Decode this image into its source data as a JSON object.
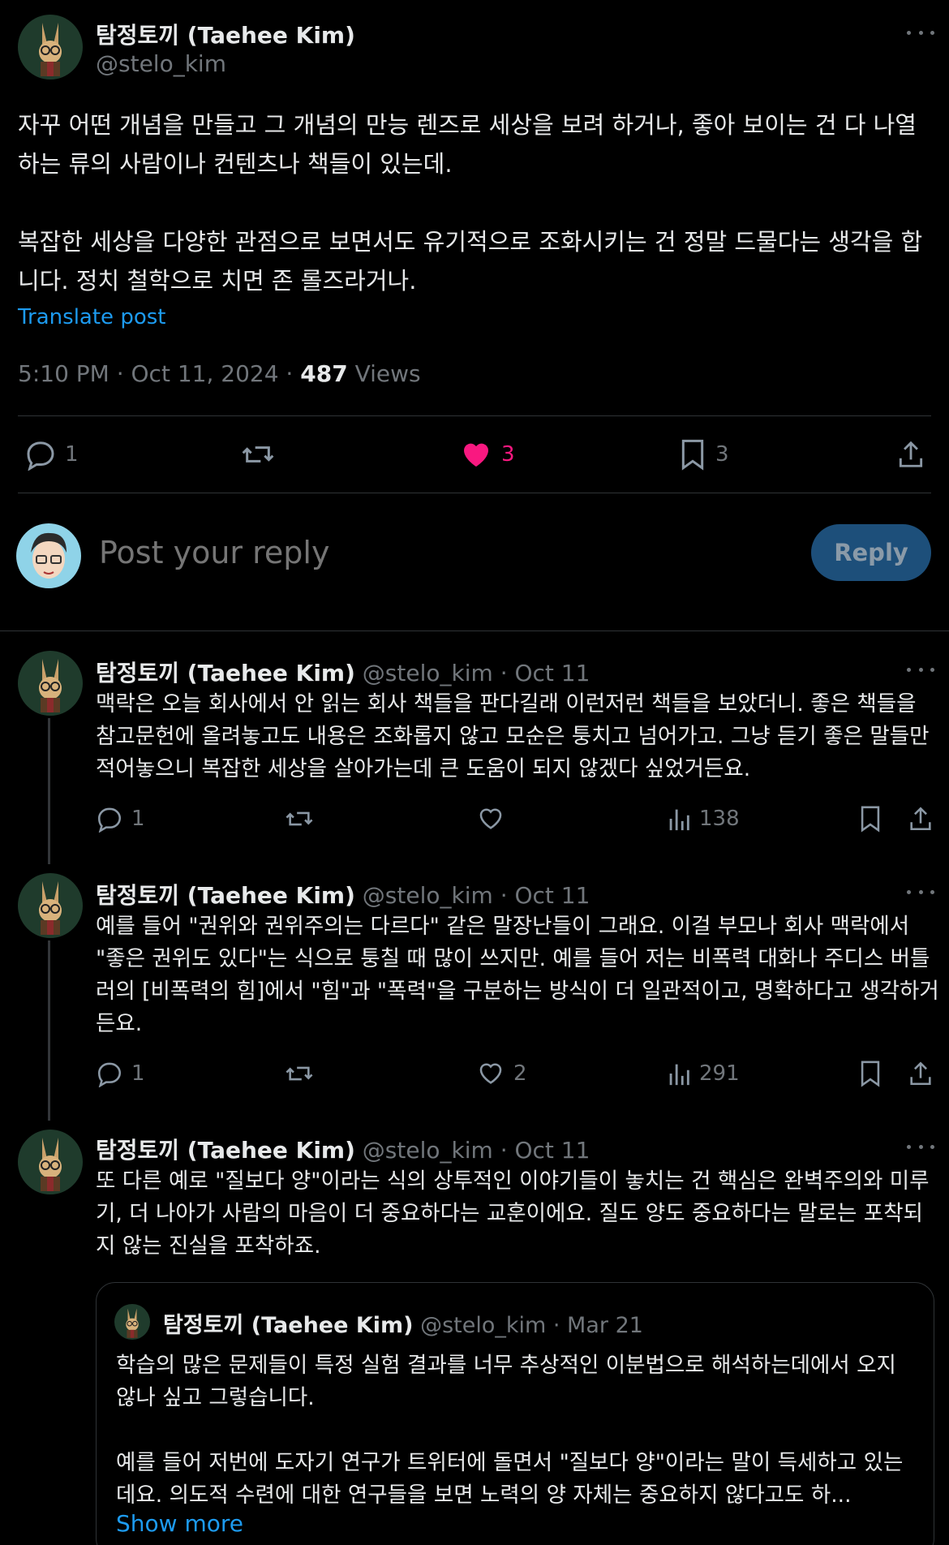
{
  "main_post": {
    "author_name": "탐정토끼 (Taehee Kim)",
    "handle": "@stelo_kim",
    "paragraphs": [
      "자꾸 어떤 개념을 만들고 그 개념의 만능 렌즈로 세상을 보려 하거나, 좋아 보이는 건 다 나열하는 류의 사람이나 컨텐츠나 책들이 있는데.",
      "복잡한 세상을 다양한 관점으로 보면서도 유기적으로 조화시키는 건 정말 드물다는 생각을 합니다. 정치 철학으로 치면 존 롤즈라거나."
    ],
    "translate_label": "Translate post",
    "timestamp": "5:10 PM · Oct 11, 2024 · ",
    "views_count": "487",
    "views_label": " Views",
    "actions": {
      "replies": "1",
      "likes": "3",
      "bookmarks": "3"
    },
    "like_color": "#f91880"
  },
  "composer": {
    "placeholder": "Post your reply",
    "reply_button": "Reply"
  },
  "replies": [
    {
      "author_name": "탐정토끼 (Taehee Kim)",
      "handle": "@stelo_kim",
      "date": "· Oct 11",
      "text": "맥락은 오늘 회사에서 안 읽는 회사 책들을 판다길래 이런저런 책들을 보았더니. 좋은 책들을 참고문헌에 올려놓고도 내용은 조화롭지 않고 모순은 퉁치고 넘어가고. 그냥 듣기 좋은 말들만 적어놓으니 복잡한 세상을 살아가는데 큰 도움이 되지 않겠다 싶었거든요.",
      "replies": "1",
      "likes": "",
      "views": "138"
    },
    {
      "author_name": "탐정토끼 (Taehee Kim)",
      "handle": "@stelo_kim",
      "date": "· Oct 11",
      "text": "예를 들어 \"권위와 권위주의는 다르다\" 같은 말장난들이 그래요. 이걸 부모나 회사 맥락에서 \"좋은 권위도 있다\"는 식으로 퉁칠 때 많이 쓰지만. 예를 들어 저는 비폭력 대화나 주디스 버틀러의 [비폭력의 힘]에서 \"힘\"과 \"폭력\"을 구분하는 방식이 더 일관적이고, 명확하다고 생각하거든요.",
      "replies": "1",
      "likes": "2",
      "views": "291"
    },
    {
      "author_name": "탐정토끼 (Taehee Kim)",
      "handle": "@stelo_kim",
      "date": "· Oct 11",
      "text": "또 다른 예로 \"질보다 양\"이라는 식의 상투적인 이야기들이 놓치는 건 핵심은 완벽주의와 미루기, 더 나아가 사람의 마음이 더 중요하다는 교훈이에요. 질도 양도 중요하다는 말로는 포착되지 않는 진실을 포착하죠."
    }
  ],
  "quote": {
    "author_name": "탐정토끼 (Taehee Kim)",
    "handle": "@stelo_kim",
    "date": "· Mar 21",
    "text": "학습의 많은 문제들이 특정 실험 결과를 너무 추상적인 이분법으로 해석하는데에서 오지 않나 싶고 그렇습니다.\n\n예를 들어 저번에 도자기 연구가 트위터에 돌면서 \"질보다 양\"이라는 말이 득세하고 있는데요. 의도적 수련에 대한 연구들을 보면 노력의 양 자체는 중요하지 않다고도 하...",
    "show_more": "Show more"
  }
}
